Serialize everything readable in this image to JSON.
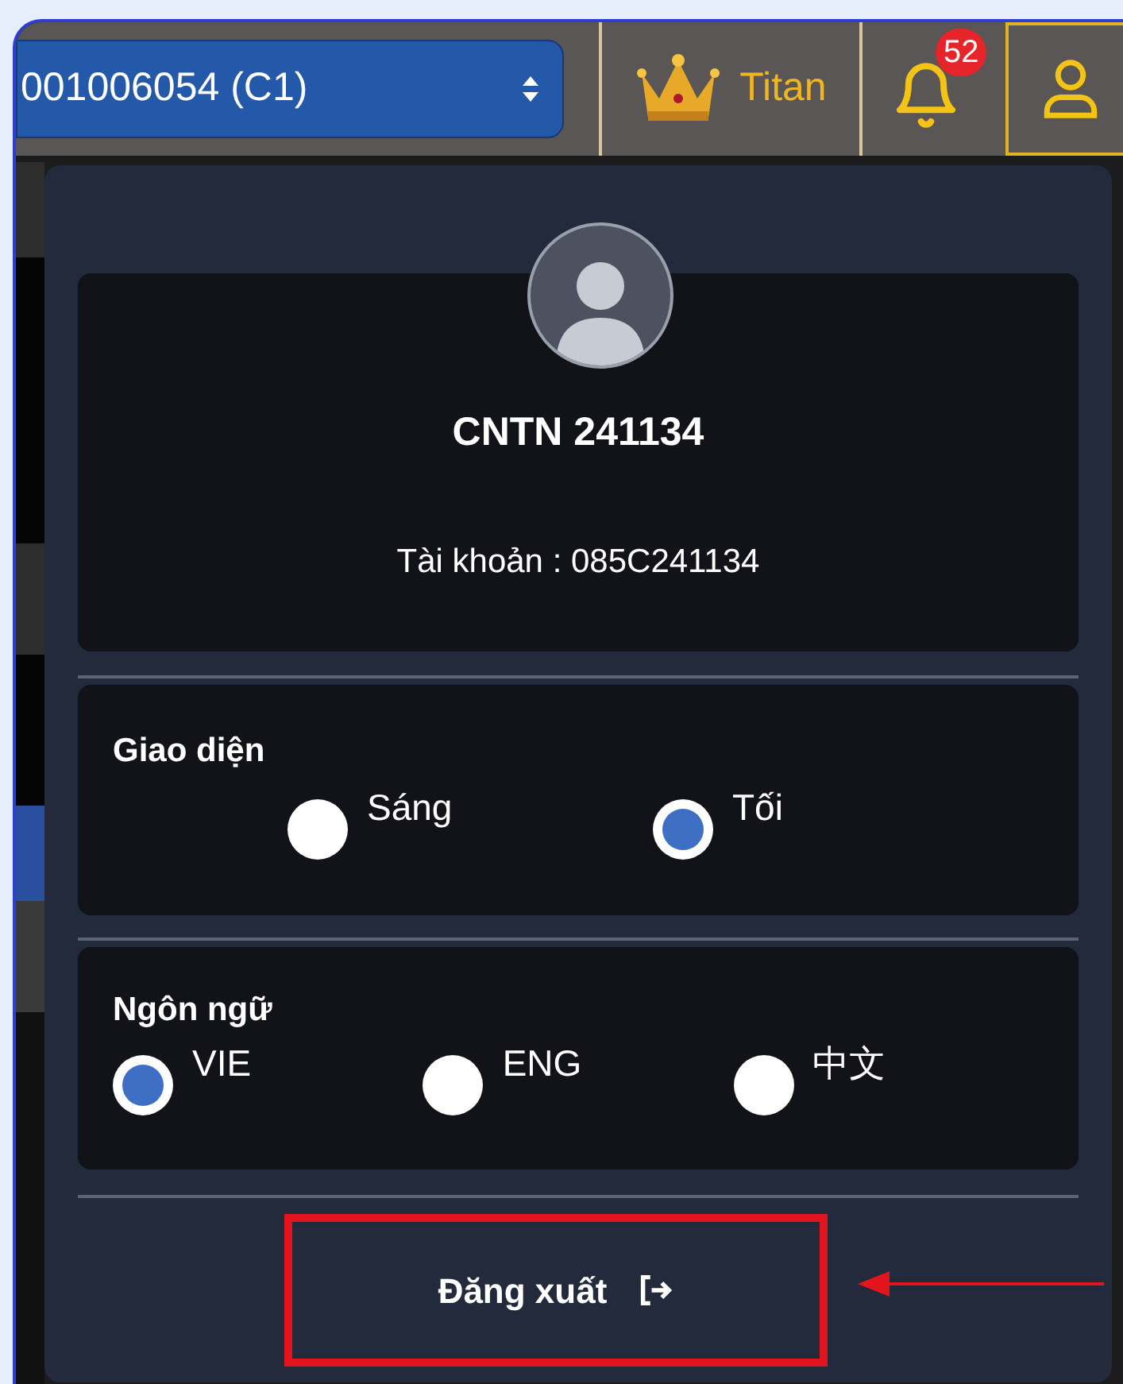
{
  "top_bar": {
    "account_select": {
      "value": "001006054 (C1)"
    },
    "tier": {
      "label": "Titan"
    },
    "notifications": {
      "count": "52"
    },
    "user_button": {
      "selected": true
    }
  },
  "user_menu": {
    "profile": {
      "name": "CNTN 241134",
      "account": "Tài khoản : 085C241134"
    },
    "theme": {
      "title": "Giao diện",
      "options": [
        {
          "label": "Sáng",
          "selected": false
        },
        {
          "label": "Tối",
          "selected": true
        }
      ]
    },
    "language": {
      "title": "Ngôn ngữ",
      "options": [
        {
          "label": "VIE",
          "selected": true
        },
        {
          "label": "ENG",
          "selected": false
        },
        {
          "label": "中文",
          "selected": false
        }
      ]
    },
    "logout": {
      "label": "Đăng xuất"
    }
  }
}
